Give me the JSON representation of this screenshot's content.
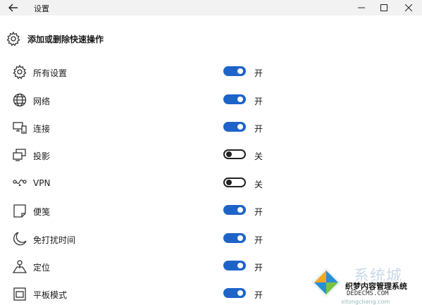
{
  "window": {
    "title": "设置",
    "back_icon": "arrow-left-icon",
    "controls": [
      "minimize-icon",
      "maximize-icon",
      "close-icon"
    ]
  },
  "header": {
    "icon": "gear-icon",
    "title": "添加或删除快速操作"
  },
  "actions": [
    {
      "label": "所有设置",
      "icon": "gear-icon",
      "on": true,
      "state": "开"
    },
    {
      "label": "网络",
      "icon": "globe-icon",
      "on": true,
      "state": "开"
    },
    {
      "label": "连接",
      "icon": "connect-icon",
      "on": true,
      "state": "开"
    },
    {
      "label": "投影",
      "icon": "project-icon",
      "on": false,
      "state": "关"
    },
    {
      "label": "VPN",
      "icon": "vpn-icon",
      "on": false,
      "state": "关"
    },
    {
      "label": "便笺",
      "icon": "note-icon",
      "on": true,
      "state": "开"
    },
    {
      "label": "免打扰时间",
      "icon": "moon-icon",
      "on": true,
      "state": "开"
    },
    {
      "label": "定位",
      "icon": "location-icon",
      "on": true,
      "state": "开"
    },
    {
      "label": "平板模式",
      "icon": "tablet-mode-icon",
      "on": true,
      "state": "开"
    }
  ],
  "colors": {
    "toggle_on": "#1e64c8",
    "toggle_off_border": "#222222",
    "titlebar_bg": "#f2f2f2"
  },
  "watermark": {
    "big_text": "系统城",
    "cms_text": "织梦内容管理系统",
    "url_text": "DEDECMS.COM",
    "site_text": "xitongcheng.com"
  }
}
